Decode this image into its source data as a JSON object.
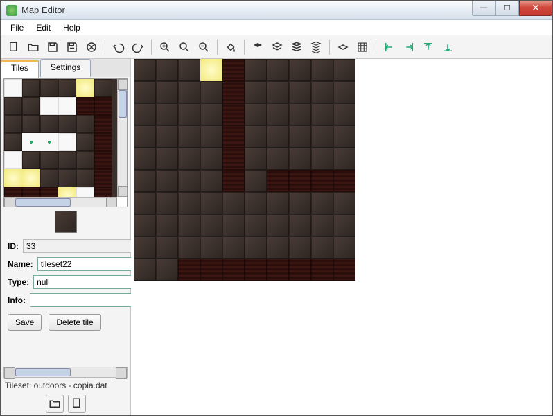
{
  "window": {
    "title": "Map Editor"
  },
  "menu": {
    "file": "File",
    "edit": "Edit",
    "help": "Help"
  },
  "tabs": {
    "tiles": "Tiles",
    "settings": "Settings"
  },
  "tile": {
    "id_label": "ID:",
    "id_value": "33",
    "name_label": "Name:",
    "name_value": "tileset22",
    "type_label": "Type:",
    "type_value": "null",
    "info_label": "Info:",
    "info_value": ""
  },
  "buttons": {
    "save": "Save",
    "delete": "Delete tile"
  },
  "status": {
    "tileset": "Tileset: outdoors - copia.dat"
  },
  "palette_grid": {
    "cols": 6,
    "rows": 7,
    "cells": [
      "white",
      "brown",
      "brown",
      "brown",
      "yellow",
      "brown",
      "brown",
      "brown",
      "white",
      "white",
      "red",
      "red",
      "brown",
      "brown",
      "brown",
      "brown",
      "brown",
      "red",
      "brown",
      "grass",
      "grass",
      "white",
      "brown",
      "red",
      "white",
      "brown",
      "brown",
      "brown",
      "brown",
      "red",
      "yellow",
      "yellow",
      "brown",
      "brown",
      "brown",
      "red",
      "red",
      "red",
      "red",
      "yellow",
      "white",
      "red"
    ]
  },
  "map_grid": {
    "cols": 10,
    "rows": 10,
    "cells": [
      "brown",
      "brown",
      "brown",
      "yellow",
      "red",
      "brown",
      "brown",
      "brown",
      "brown",
      "brown",
      "brown",
      "brown",
      "brown",
      "brown",
      "red",
      "brown",
      "brown",
      "brown",
      "brown",
      "brown",
      "brown",
      "brown",
      "brown",
      "brown",
      "red",
      "brown",
      "brown",
      "brown",
      "brown",
      "brown",
      "brown",
      "brown",
      "brown",
      "brown",
      "red",
      "brown",
      "brown",
      "brown",
      "brown",
      "brown",
      "brown",
      "brown",
      "brown",
      "brown",
      "red",
      "brown",
      "brown",
      "brown",
      "brown",
      "brown",
      "brown",
      "brown",
      "brown",
      "brown",
      "red",
      "brown",
      "red",
      "red",
      "red",
      "red",
      "brown",
      "brown",
      "brown",
      "brown",
      "brown",
      "brown",
      "brown",
      "brown",
      "brown",
      "brown",
      "brown",
      "brown",
      "brown",
      "brown",
      "brown",
      "brown",
      "brown",
      "brown",
      "brown",
      "brown",
      "brown",
      "brown",
      "brown",
      "brown",
      "brown",
      "brown",
      "brown",
      "brown",
      "brown",
      "brown",
      "brown",
      "brown",
      "red",
      "red",
      "red",
      "red",
      "red",
      "red",
      "red",
      "red"
    ]
  }
}
